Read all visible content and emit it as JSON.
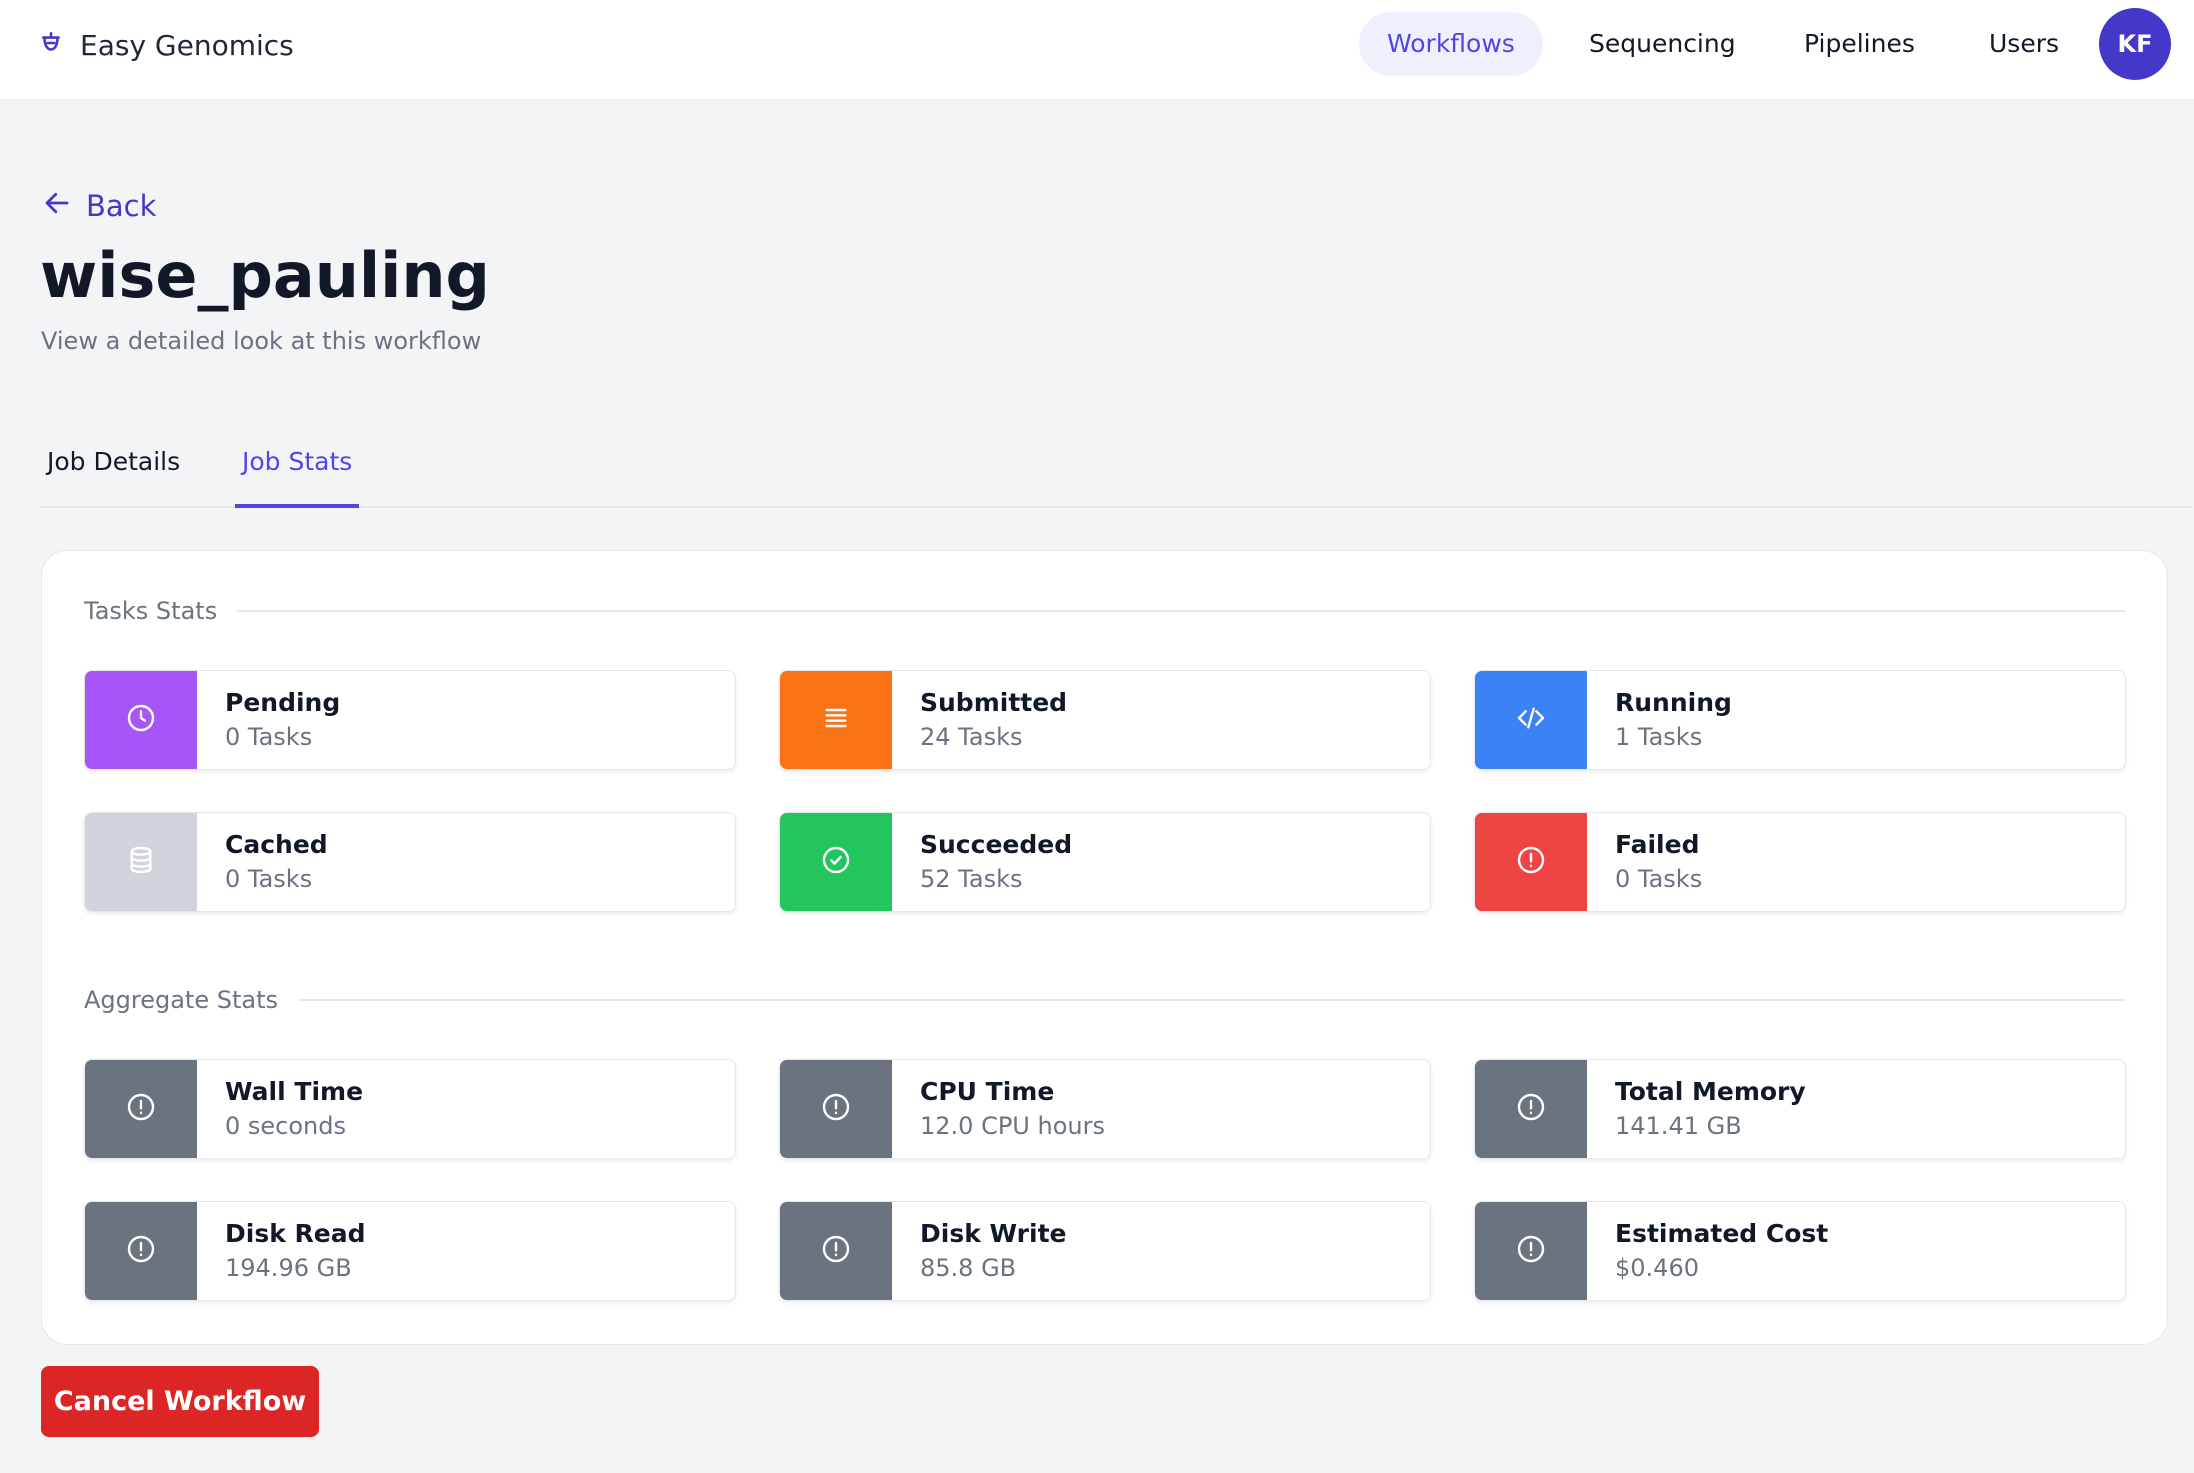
{
  "app": {
    "name": "Easy Genomics",
    "logo_icon": "logo-icon"
  },
  "nav": {
    "items": [
      {
        "label": "Workflows",
        "active": true
      },
      {
        "label": "Sequencing",
        "active": false
      },
      {
        "label": "Pipelines",
        "active": false
      },
      {
        "label": "Users",
        "active": false
      }
    ],
    "avatar_initials": "KF"
  },
  "header": {
    "back_label": "Back",
    "title": "wise_pauling",
    "subtitle": "View a detailed look at this workflow"
  },
  "tabs": [
    {
      "label": "Job Details",
      "active": false
    },
    {
      "label": "Job Stats",
      "active": true
    }
  ],
  "tasks_stats": {
    "title": "Tasks Stats",
    "cards": [
      {
        "label": "Pending",
        "value": "0 Tasks",
        "icon": "clock-icon",
        "color": "#a855f7"
      },
      {
        "label": "Submitted",
        "value": "24 Tasks",
        "icon": "list-icon",
        "color": "#f97316"
      },
      {
        "label": "Running",
        "value": "1 Tasks",
        "icon": "code-icon",
        "color": "#3b82f6"
      },
      {
        "label": "Cached",
        "value": "0 Tasks",
        "icon": "database-icon",
        "color": "#d1d5db"
      },
      {
        "label": "Succeeded",
        "value": "52 Tasks",
        "icon": "check-circle-icon",
        "color": "#22c55e"
      },
      {
        "label": "Failed",
        "value": "0 Tasks",
        "icon": "alert-circle-icon",
        "color": "#ef4444"
      }
    ]
  },
  "aggregate_stats": {
    "title": "Aggregate Stats",
    "cards": [
      {
        "label": "Wall Time",
        "value": "0 seconds",
        "icon": "alert-circle-icon",
        "color": "#6b7280"
      },
      {
        "label": "CPU Time",
        "value": "12.0 CPU hours",
        "icon": "alert-circle-icon",
        "color": "#6b7280"
      },
      {
        "label": "Total Memory",
        "value": "141.41 GB",
        "icon": "alert-circle-icon",
        "color": "#6b7280"
      },
      {
        "label": "Disk Read",
        "value": "194.96 GB",
        "icon": "alert-circle-icon",
        "color": "#6b7280"
      },
      {
        "label": "Disk Write",
        "value": "85.8 GB",
        "icon": "alert-circle-icon",
        "color": "#6b7280"
      },
      {
        "label": "Estimated Cost",
        "value": "$0.460",
        "icon": "alert-circle-icon",
        "color": "#6b7280"
      }
    ]
  },
  "actions": {
    "cancel_label": "Cancel Workflow",
    "cancel_color": "#dc2626"
  },
  "colors": {
    "accent": "#4f46e5",
    "page_background": "#f3f4f6"
  }
}
